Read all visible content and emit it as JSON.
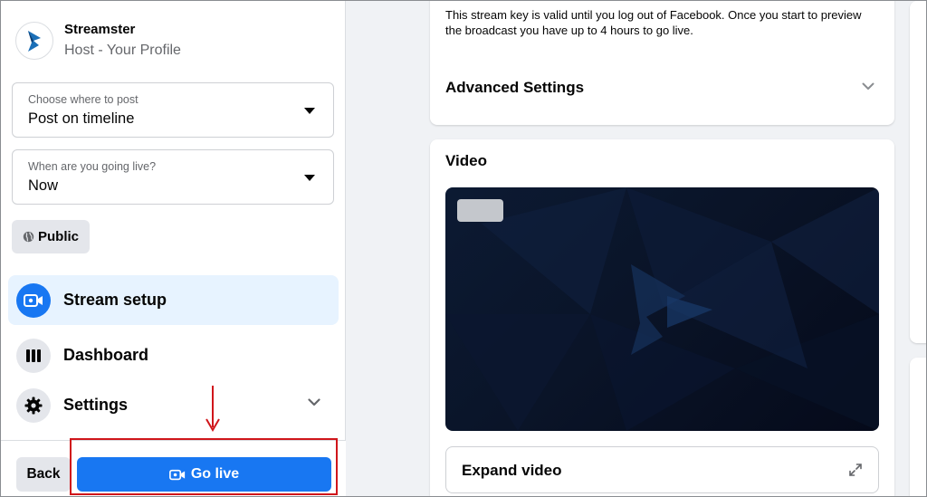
{
  "host": {
    "name": "Streamster",
    "subtitle": "Host - Your Profile"
  },
  "post_location": {
    "label": "Choose where to post",
    "value": "Post on timeline"
  },
  "go_live_time": {
    "label": "When are you going live?",
    "value": "Now"
  },
  "audience": {
    "label": "Public"
  },
  "nav": {
    "items": [
      {
        "label": "Stream setup",
        "icon": "camera-icon",
        "active": true
      },
      {
        "label": "Dashboard",
        "icon": "dashboard-icon",
        "active": false
      },
      {
        "label": "Settings",
        "icon": "gear-icon",
        "active": false
      }
    ]
  },
  "footer": {
    "back_label": "Back",
    "go_live_label": "Go live"
  },
  "stream_key": {
    "notice": "This stream key is valid until you log out of Facebook. Once you start to preview the broadcast you have up to 4 hours to go live."
  },
  "advanced": {
    "title": "Advanced Settings"
  },
  "video": {
    "title": "Video",
    "expand_label": "Expand video"
  },
  "colors": {
    "accent": "#1877f2",
    "highlight": "#d0161b"
  }
}
